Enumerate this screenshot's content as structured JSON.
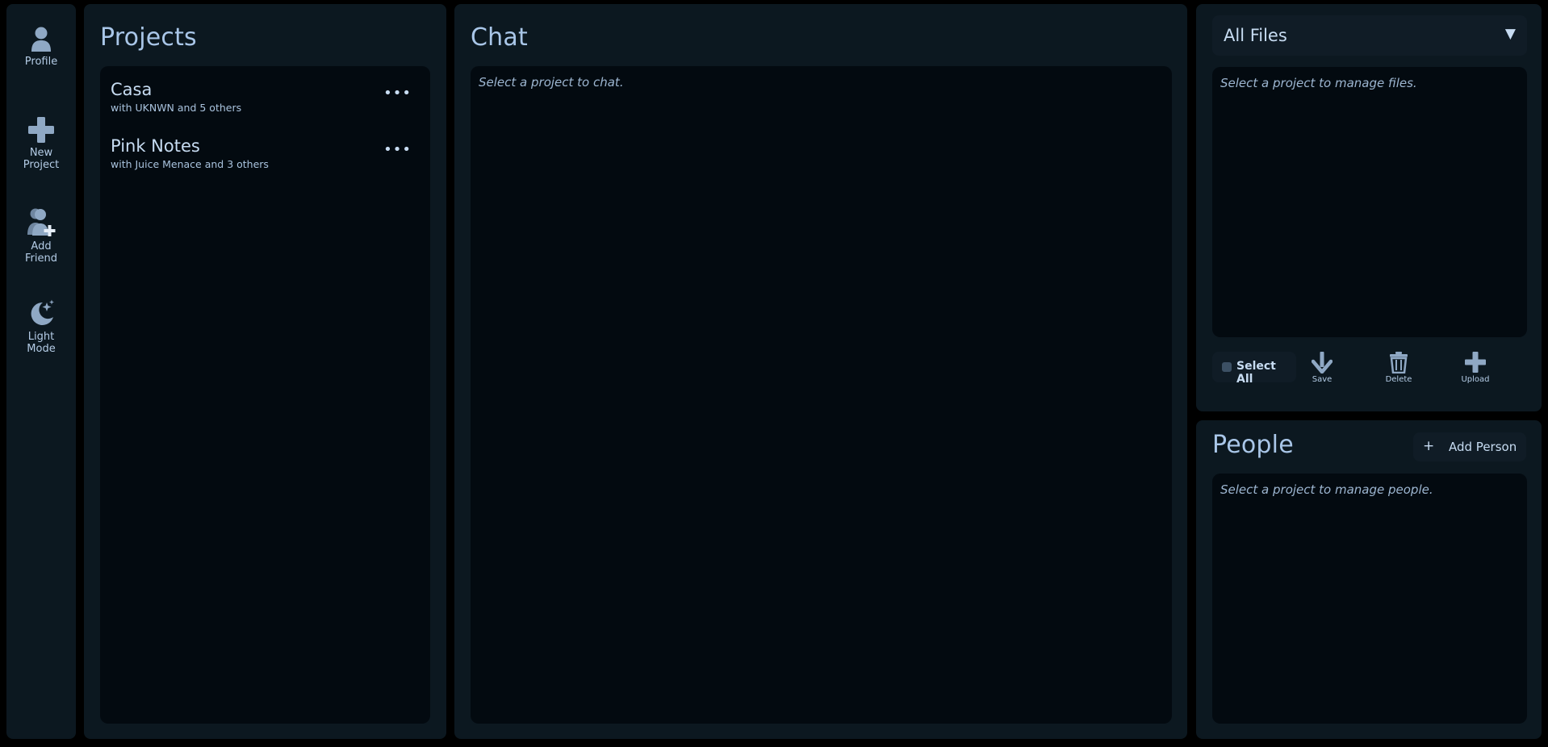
{
  "sidebar": {
    "items": [
      {
        "label": "Profile",
        "icon": "person-icon"
      },
      {
        "label": "New\nProject",
        "icon": "plus-icon"
      },
      {
        "label": "Add\nFriend",
        "icon": "add-friend-icon"
      },
      {
        "label": "Light\nMode",
        "icon": "moon-stars-icon"
      }
    ]
  },
  "projects": {
    "title": "Projects",
    "items": [
      {
        "name": "Casa",
        "members": "with UKNWN and 5 others",
        "more": "•••"
      },
      {
        "name": "Pink Notes",
        "members": "with Juice Menace and 3 others",
        "more": "•••"
      }
    ]
  },
  "chat": {
    "title": "Chat",
    "placeholder": "Select a project to chat."
  },
  "files": {
    "filter_selected": "All Files",
    "dropdown_arrow": "▼",
    "placeholder": "Select a project to manage files.",
    "select_all": "Select All",
    "actions": [
      {
        "label": "Save",
        "icon": "download-arrow-icon"
      },
      {
        "label": "Delete",
        "icon": "trash-icon"
      },
      {
        "label": "Upload",
        "icon": "plus-icon"
      }
    ]
  },
  "people": {
    "title": "People",
    "add_button_plus": "+",
    "add_button": "Add Person",
    "placeholder": "Select a project to manage people."
  },
  "colors": {
    "page_bg": "#000000",
    "panel_bg": "#0c1820",
    "inner_bg": "#030a10",
    "text": "#c7dcf2",
    "title": "#a9c6e8",
    "icon": "#8fa8c4"
  }
}
